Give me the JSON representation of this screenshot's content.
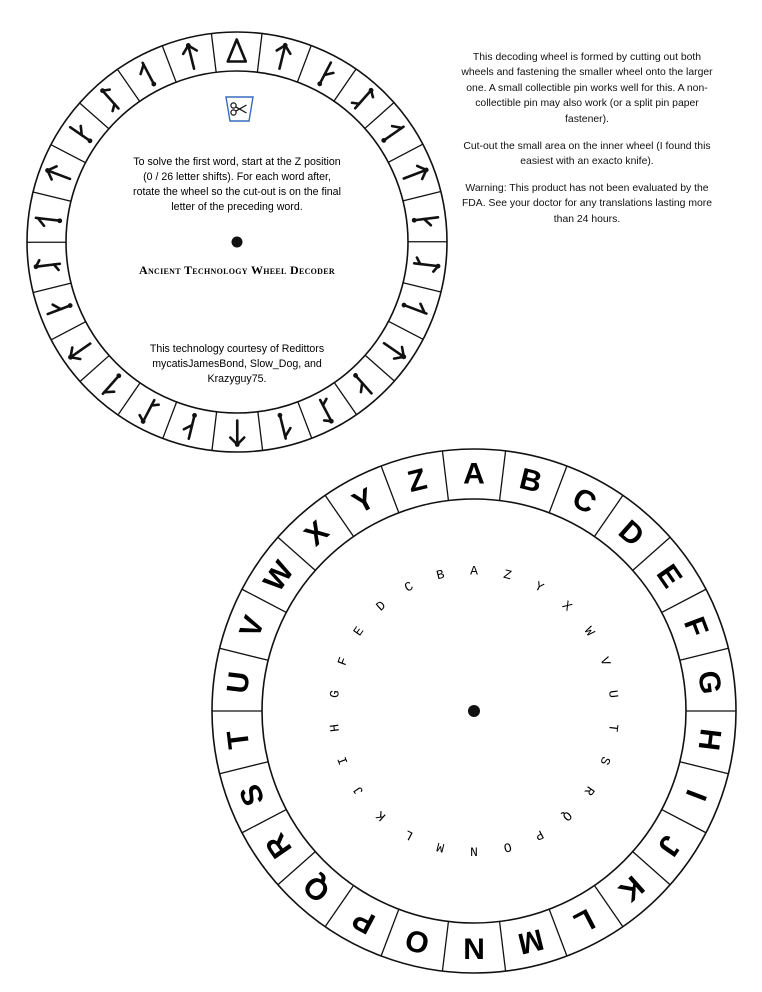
{
  "info_paragraphs": [
    "This decoding wheel is formed by cutting out both wheels and fastening the smaller wheel onto the larger one.  A small collectible pin works well for this.  A non-collectible pin may also work (or a split pin paper fastener).",
    "Cut-out the small area on the inner wheel (I found this easiest with an exacto knife).",
    "Warning: This product has not been evaluated by the FDA.  See your doctor for any translations lasting more than 24 hours."
  ],
  "inner_wheel": {
    "instructions": [
      "To solve the first word, start at the Z position",
      "(0 / 26 letter shifts).  For each word after,",
      "rotate the wheel so the cut-out is on the final",
      "letter of the preceding word."
    ],
    "title": "Ancient Technology Wheel Decoder",
    "credits": [
      "This technology courtesy of Redittors",
      "mycatisJamesBond, Slow_Dog, and",
      "Krazyguy75."
    ],
    "cutout_icon": "scissors-icon",
    "segment_count": 26
  },
  "outer_wheel": {
    "ring_letters": [
      "A",
      "B",
      "C",
      "D",
      "E",
      "F",
      "G",
      "H",
      "I",
      "J",
      "K",
      "L",
      "M",
      "N",
      "O",
      "P",
      "Q",
      "R",
      "S",
      "T",
      "U",
      "V",
      "W",
      "X",
      "Y",
      "Z"
    ],
    "inner_letters": [
      "A",
      "Z",
      "Y",
      "X",
      "W",
      "V",
      "U",
      "T",
      "S",
      "R",
      "Q",
      "P",
      "O",
      "N",
      "M",
      "L",
      "K",
      "J",
      "I",
      "H",
      "G",
      "F",
      "E",
      "D",
      "C",
      "B"
    ]
  }
}
